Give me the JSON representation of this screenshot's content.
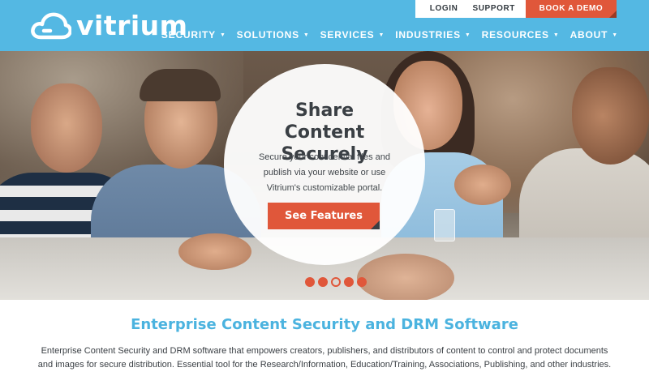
{
  "brand": {
    "name": "vitrium",
    "primary_color": "#54b8e3",
    "accent_color": "#e0573a"
  },
  "utility_nav": {
    "login": "LOGIN",
    "support": "SUPPORT",
    "book_demo": "BOOK A DEMO"
  },
  "main_nav": [
    {
      "label": "SECURITY",
      "icon": "chevron-down-icon"
    },
    {
      "label": "SOLUTIONS",
      "icon": "chevron-down-icon"
    },
    {
      "label": "SERVICES",
      "icon": "chevron-down-icon"
    },
    {
      "label": "INDUSTRIES",
      "icon": "chevron-down-icon"
    },
    {
      "label": "RESOURCES",
      "icon": "chevron-down-icon"
    },
    {
      "label": "ABOUT",
      "icon": "chevron-down-icon"
    }
  ],
  "hero": {
    "title": "Share Content Securely",
    "text": "Secure your confidential files and publish via your website or use Vitrium's customizable portal.",
    "cta": "See Features",
    "slides": 5,
    "active_slide": 3
  },
  "intro": {
    "title": "Enterprise Content Security and DRM Software",
    "text": "Enterprise Content Security and DRM software that empowers creators, publishers, and distributors of content to control and protect documents and images for secure distribution. Essential tool for the Research/Information, Education/Training, Associations, Publishing, and other industries."
  }
}
